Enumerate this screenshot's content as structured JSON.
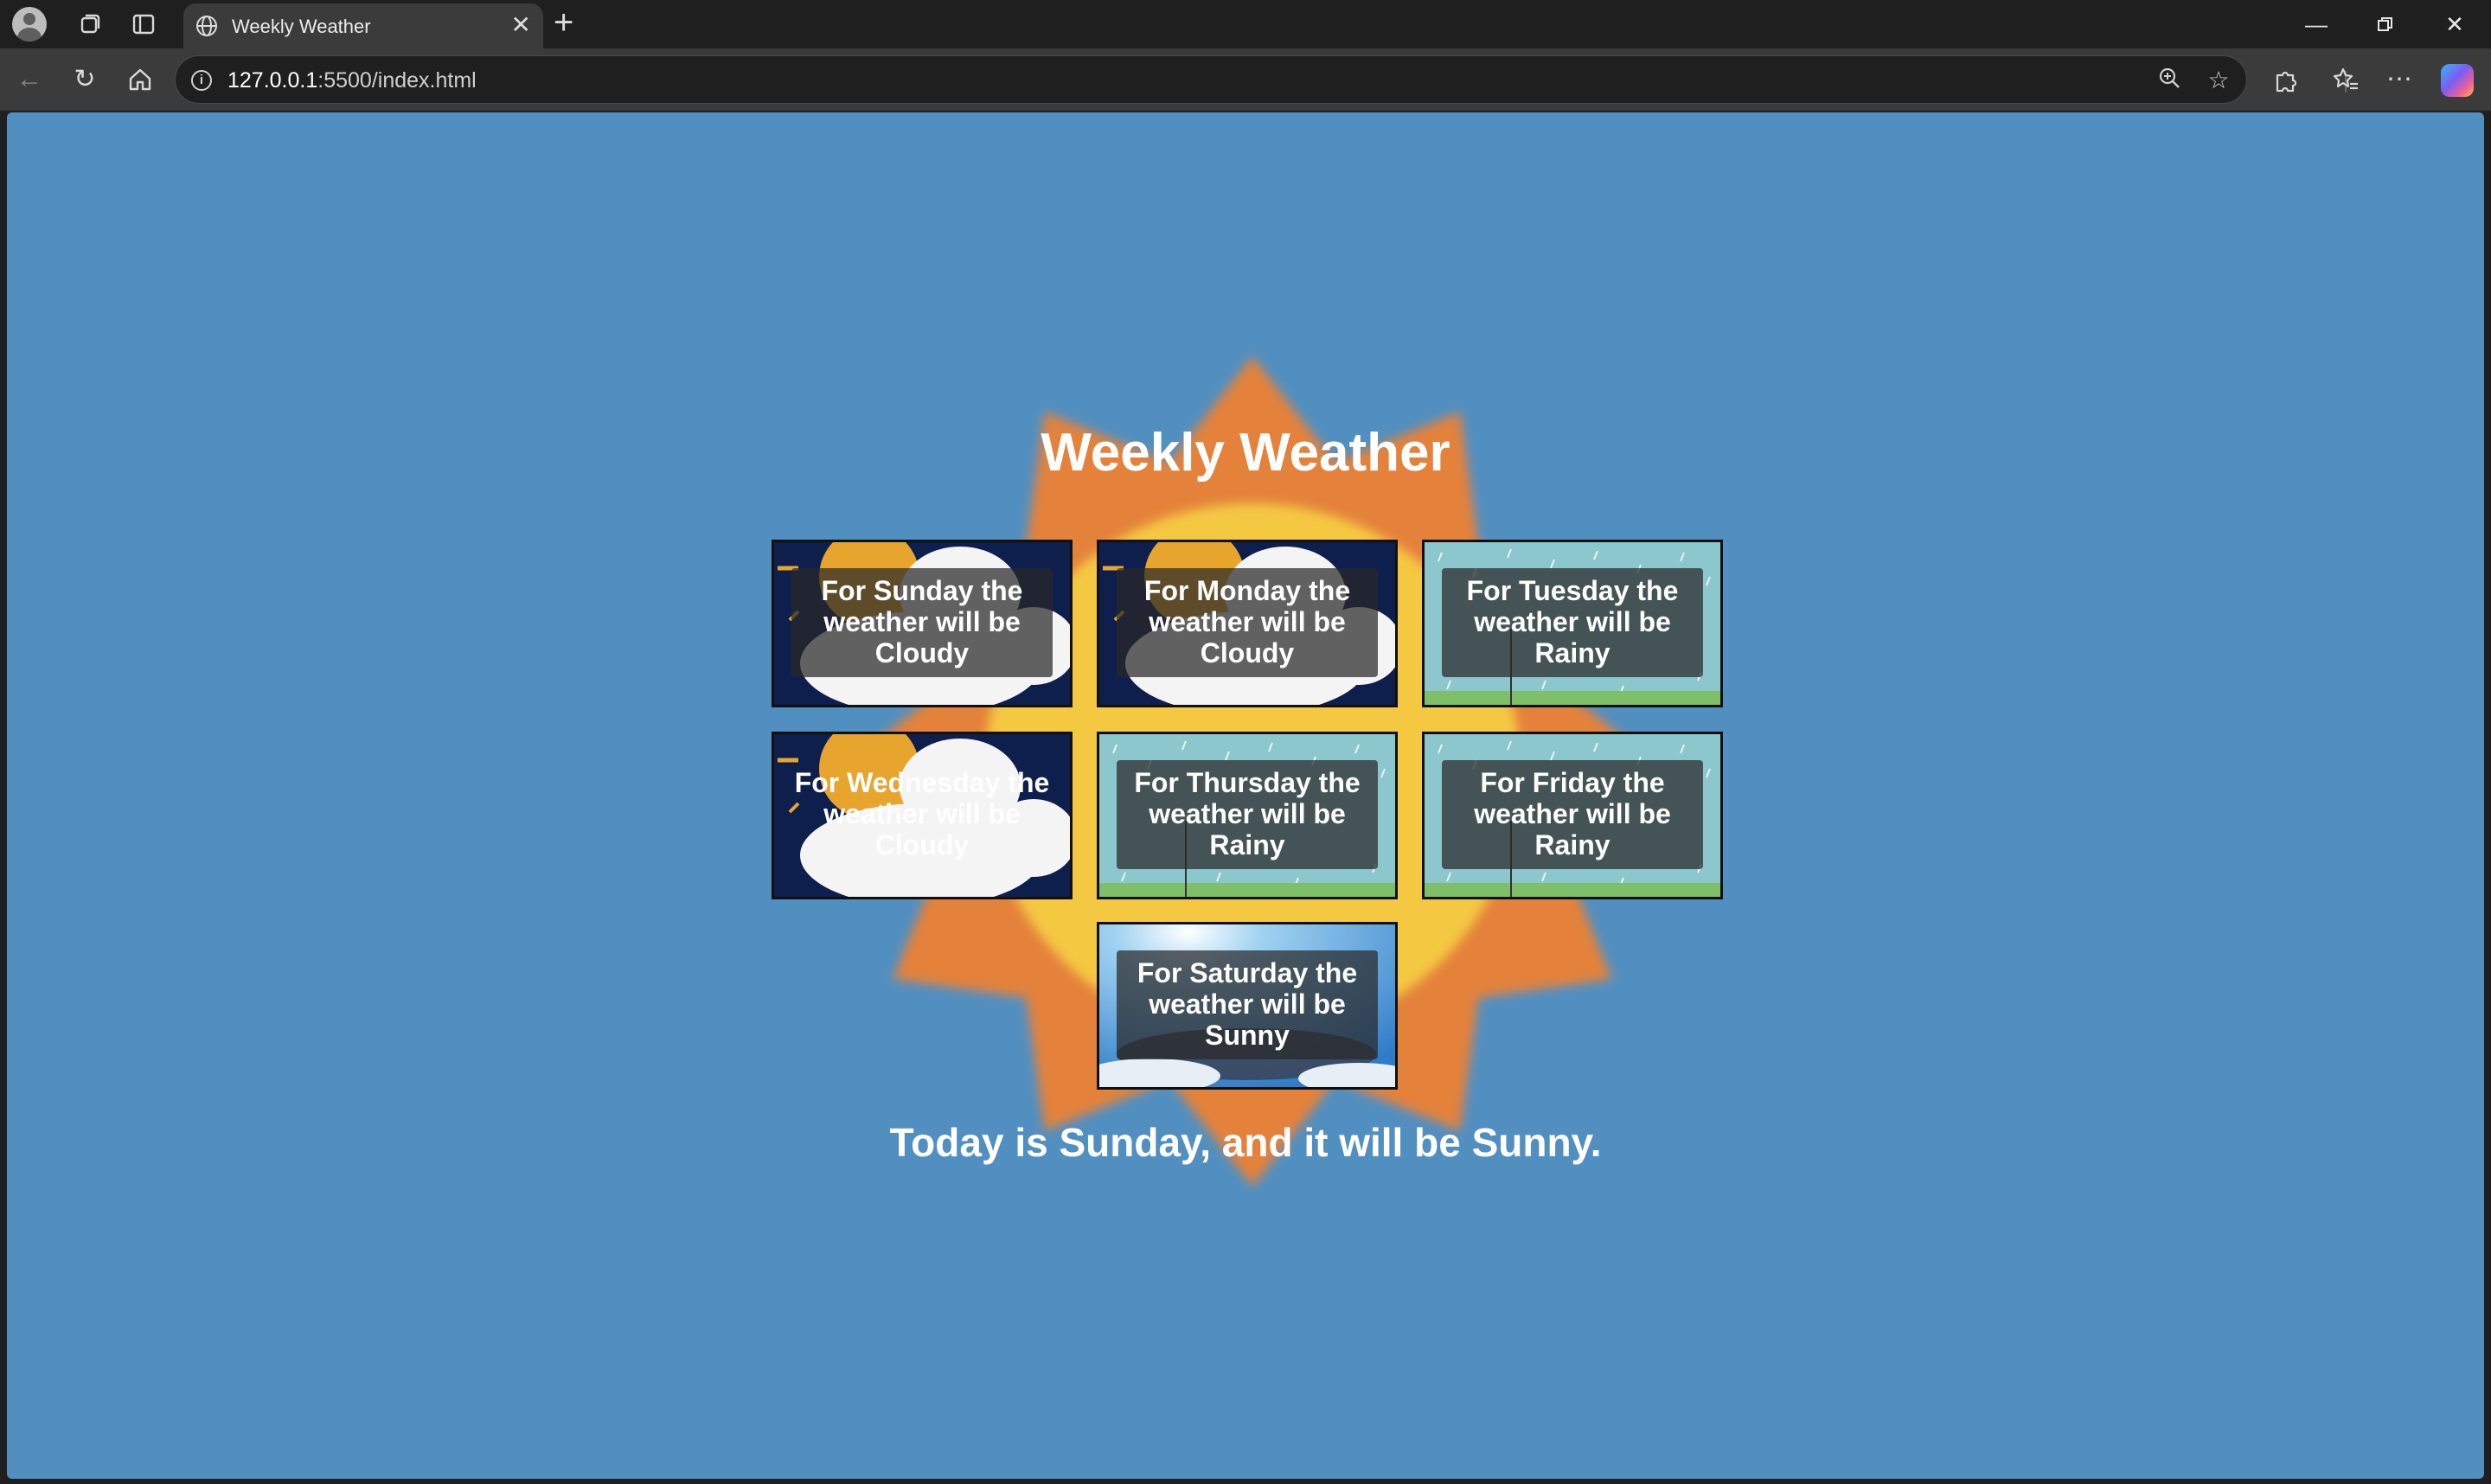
{
  "browser": {
    "tab_title": "Weekly Weather",
    "url_host": "127.0.0.1",
    "url_rest": ":5500/index.html"
  },
  "page": {
    "title": "Weekly Weather",
    "today_message": "Today is Sunday, and it will be Sunny.",
    "colors": {
      "background": "#518fc1",
      "sun_outer": "#e4823a",
      "sun_inner": "#f5c842"
    },
    "days": [
      {
        "day": "Sunday",
        "condition": "Cloudy",
        "caption": "For Sunday the weather will be Cloudy"
      },
      {
        "day": "Monday",
        "condition": "Cloudy",
        "caption": "For Monday the weather will be Cloudy"
      },
      {
        "day": "Tuesday",
        "condition": "Rainy",
        "caption": "For Tuesday the weather will be Rainy"
      },
      {
        "day": "Wednesday",
        "condition": "Cloudy",
        "caption": "For Wednesday the weather will be Cloudy"
      },
      {
        "day": "Thursday",
        "condition": "Rainy",
        "caption": "For Thursday the weather will be Rainy"
      },
      {
        "day": "Friday",
        "condition": "Rainy",
        "caption": "For Friday the weather will be Rainy"
      },
      {
        "day": "Saturday",
        "condition": "Sunny",
        "caption": "For Saturday the weather will be Sunny"
      }
    ]
  }
}
